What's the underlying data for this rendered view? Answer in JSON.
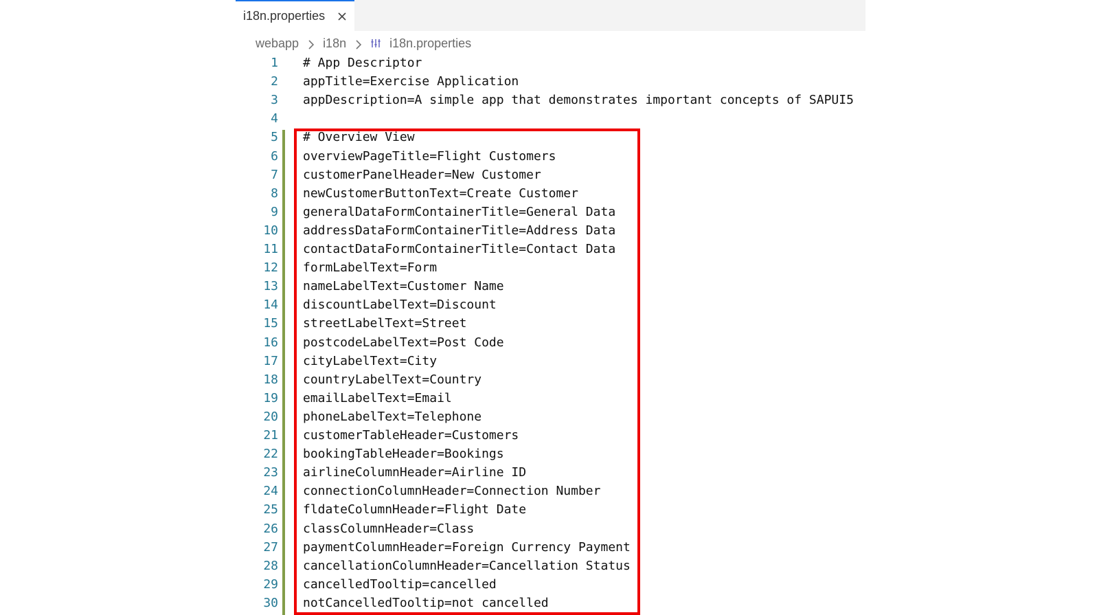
{
  "tab": {
    "label": "i18n.properties",
    "close_icon": "close-icon"
  },
  "breadcrumb": {
    "items": [
      "webapp",
      "i18n",
      "i18n.properties"
    ],
    "separator_icon": "chevron-right-icon",
    "file_icon": "properties-file-icon"
  },
  "editor": {
    "lines": [
      {
        "number": "1",
        "text": "# App Descriptor"
      },
      {
        "number": "2",
        "text": "appTitle=Exercise Application"
      },
      {
        "number": "3",
        "text": "appDescription=A simple app that demonstrates important concepts of SAPUI5"
      },
      {
        "number": "4",
        "text": ""
      },
      {
        "number": "5",
        "text": "# Overview View"
      },
      {
        "number": "6",
        "text": "overviewPageTitle=Flight Customers"
      },
      {
        "number": "7",
        "text": "customerPanelHeader=New Customer"
      },
      {
        "number": "8",
        "text": "newCustomerButtonText=Create Customer"
      },
      {
        "number": "9",
        "text": "generalDataFormContainerTitle=General Data"
      },
      {
        "number": "10",
        "text": "addressDataFormContainerTitle=Address Data"
      },
      {
        "number": "11",
        "text": "contactDataFormContainerTitle=Contact Data"
      },
      {
        "number": "12",
        "text": "formLabelText=Form"
      },
      {
        "number": "13",
        "text": "nameLabelText=Customer Name"
      },
      {
        "number": "14",
        "text": "discountLabelText=Discount"
      },
      {
        "number": "15",
        "text": "streetLabelText=Street"
      },
      {
        "number": "16",
        "text": "postcodeLabelText=Post Code"
      },
      {
        "number": "17",
        "text": "cityLabelText=City"
      },
      {
        "number": "18",
        "text": "countryLabelText=Country"
      },
      {
        "number": "19",
        "text": "emailLabelText=Email"
      },
      {
        "number": "20",
        "text": "phoneLabelText=Telephone"
      },
      {
        "number": "21",
        "text": "customerTableHeader=Customers"
      },
      {
        "number": "22",
        "text": "bookingTableHeader=Bookings"
      },
      {
        "number": "23",
        "text": "airlineColumnHeader=Airline ID"
      },
      {
        "number": "24",
        "text": "connectionColumnHeader=Connection Number"
      },
      {
        "number": "25",
        "text": "fldateColumnHeader=Flight Date"
      },
      {
        "number": "26",
        "text": "classColumnHeader=Class"
      },
      {
        "number": "27",
        "text": "paymentColumnHeader=Foreign Currency Payment"
      },
      {
        "number": "28",
        "text": "cancellationColumnHeader=Cancellation Status"
      },
      {
        "number": "29",
        "text": "cancelledTooltip=cancelled"
      },
      {
        "number": "30",
        "text": "notCancelledTooltip=not cancelled"
      }
    ]
  },
  "colors": {
    "tab_accent": "#1a73e8",
    "line_number": "#237893",
    "gutter_modified": "#587c0c",
    "highlight": "#ee0000"
  }
}
